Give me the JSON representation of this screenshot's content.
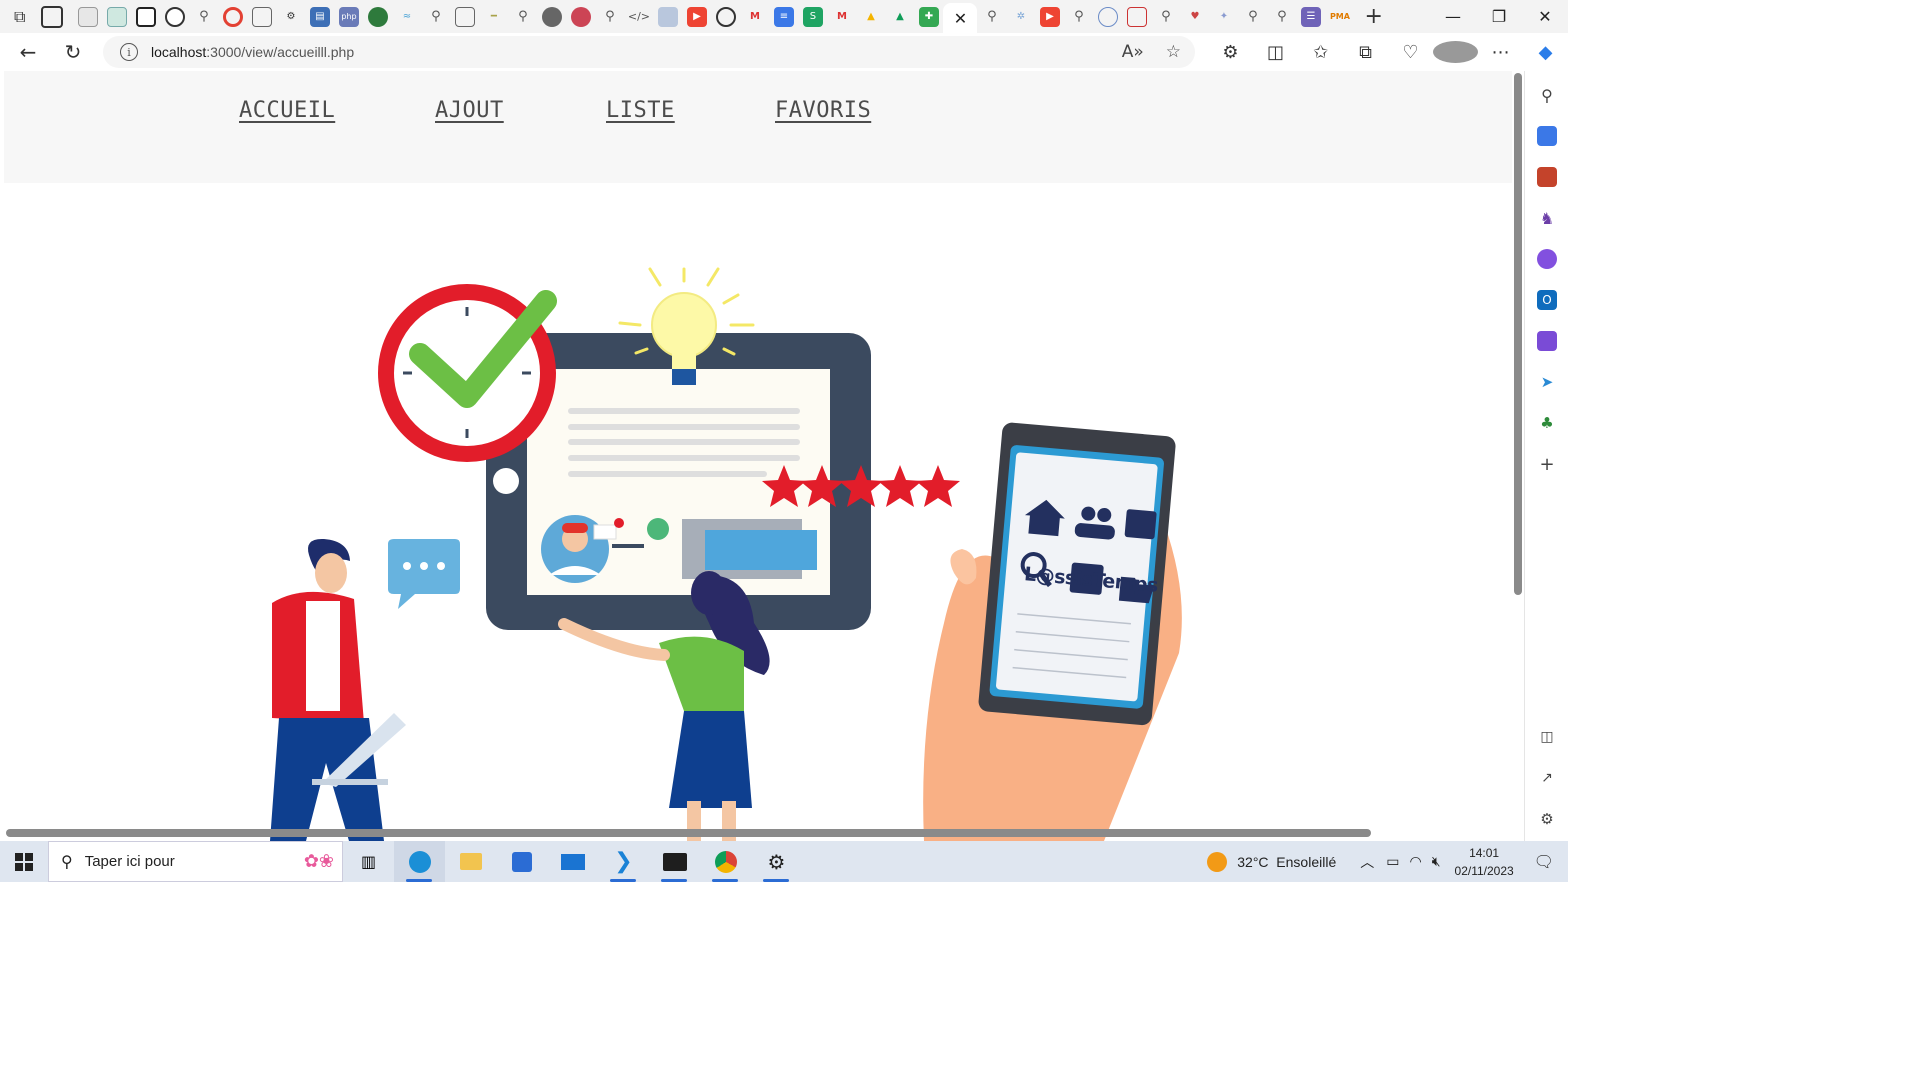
{
  "browser": {
    "url_host": "localhost",
    "url_path": ":3000/view/accueilll.php",
    "active_tab_close": "✕",
    "new_tab": "+",
    "window_controls": [
      "—",
      "❐",
      "✕"
    ]
  },
  "page": {
    "nav": [
      "ACCUEIL",
      "AJOUT",
      "LISTE",
      "FAVORIS"
    ],
    "hero": {
      "app_logo_text": "L@ssisTemps",
      "rating_stars": 5
    }
  },
  "taskbar": {
    "search_placeholder": "Taper ici pour",
    "weather": "32°C  Ensoleillé",
    "time": "14:01",
    "date": "02/11/2023"
  },
  "colors": {
    "accent_red": "#e21d2a",
    "green": "#6cbf45",
    "tablet_frame": "#3b4a5f",
    "edge_blue": "#2b6cd4"
  },
  "icons": {
    "tabbar": [
      "workspaces-icon",
      "tab-actions-icon",
      "github-icon",
      "search-icon",
      "document-icon",
      "php-icon",
      "youtube-icon",
      "gmail-icon",
      "google-drive-icon",
      "add-tab-icon"
    ],
    "sidebar": [
      "search-icon",
      "tag-icon",
      "toolbox-icon",
      "chess-icon",
      "office-icon",
      "outlook-icon",
      "designer-icon",
      "send-icon",
      "tree-icon",
      "add-icon"
    ]
  }
}
